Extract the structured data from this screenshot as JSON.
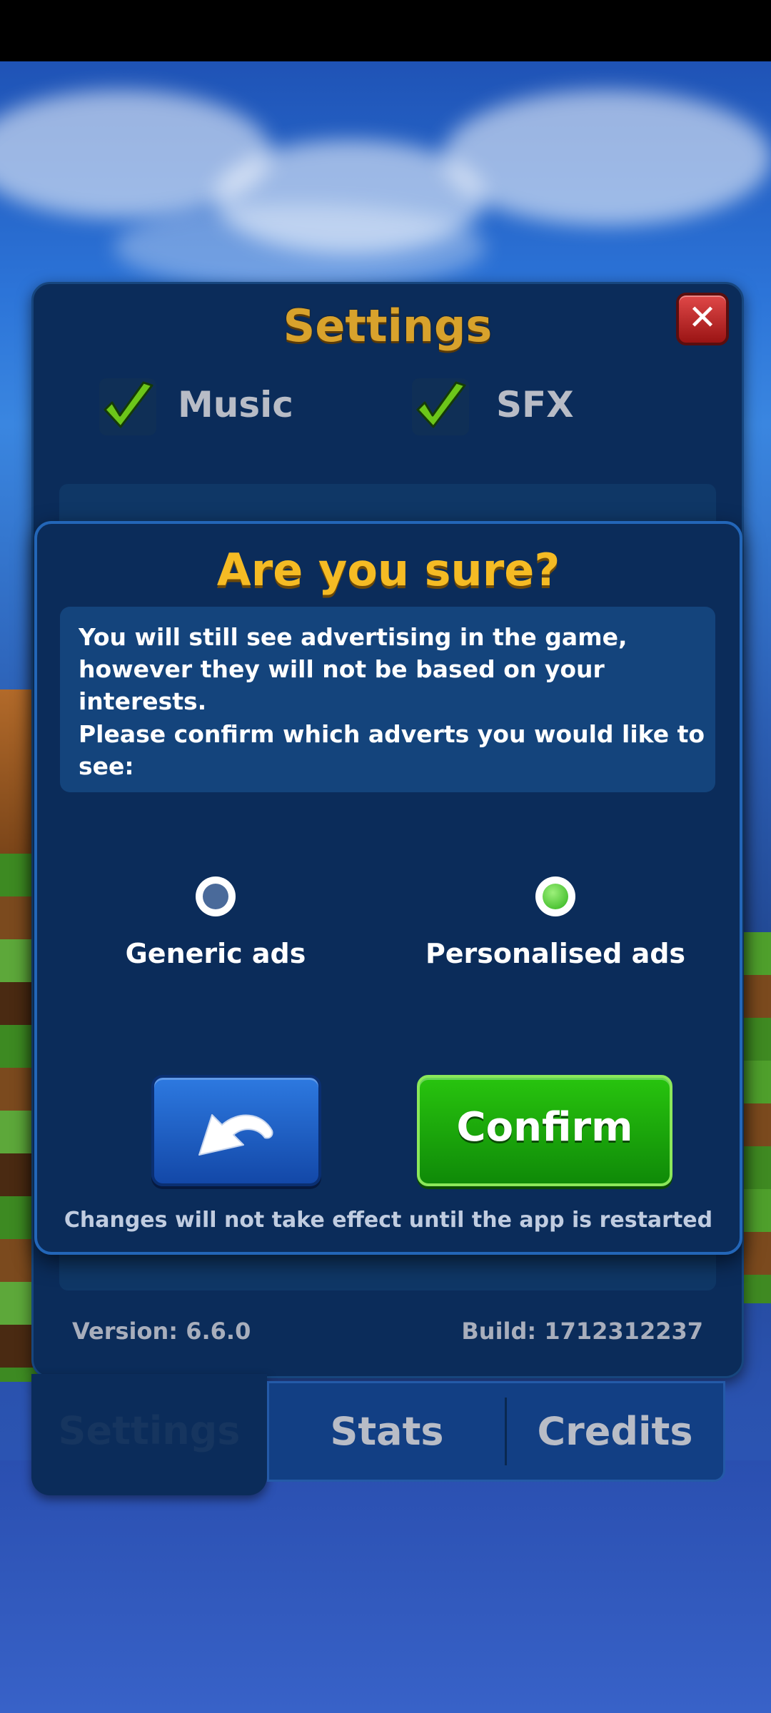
{
  "settings_panel": {
    "title": "Settings",
    "music_label": "Music",
    "sfx_label": "SFX",
    "music_checked": true,
    "sfx_checked": true,
    "version": "Version: 6.6.0",
    "build": "Build: 1712312237"
  },
  "tabs": {
    "settings": "Settings",
    "stats": "Stats",
    "credits": "Credits"
  },
  "dialog": {
    "title": "Are you sure?",
    "message_1": "You will still see advertising in the game, however they will not be based on your interests.",
    "message_2": "Please confirm which adverts you would like to see:",
    "option_generic": "Generic ads",
    "option_personalised": "Personalised ads",
    "selected_option": "Personalised ads",
    "confirm_label": "Confirm",
    "note": "Changes will not take effect until the app is restarted"
  },
  "colors": {
    "title_gold": "#d8a22c",
    "dialog_title": "#f5bb24",
    "confirm_green": "#28c40e",
    "back_blue": "#2d79e0",
    "close_red": "#e04848",
    "selected_radio": "#4ccf3a",
    "unselected_radio": "#4a6a9a"
  }
}
